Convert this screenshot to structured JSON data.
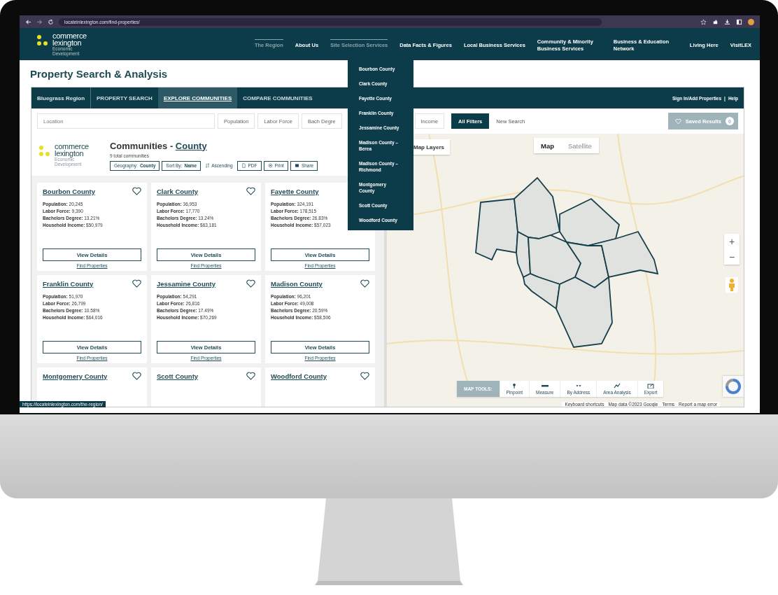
{
  "browser": {
    "url": "locateinlexington.com/find-properties/"
  },
  "site_header": {
    "logo": {
      "line_1": "commerce",
      "line_2": "lexington",
      "tagline_1": "Economic",
      "tagline_2": "Development"
    },
    "nav": [
      {
        "label": "The Region",
        "highlighted": true
      },
      {
        "label": "About Us",
        "highlighted": false
      },
      {
        "label": "Site Selection Services",
        "highlighted": true
      },
      {
        "label": "Data Facts & Figures",
        "highlighted": false
      },
      {
        "label": "Local Business Services",
        "highlighted": false
      },
      {
        "label": "Community & Minority Business Services",
        "highlighted": false
      },
      {
        "label": "Business & Education Network",
        "highlighted": false
      },
      {
        "label": "Living Here",
        "highlighted": false
      },
      {
        "label": "VisitLEX",
        "highlighted": false
      }
    ]
  },
  "region_menu": [
    "Bourbon County",
    "Clark County",
    "Fayette County",
    "Franklin County",
    "Jessamine County",
    "Madison County – Berea",
    "Madison County – Richmond",
    "Montgomery County",
    "Scott County",
    "Woodford County"
  ],
  "page_title": "Property Search & Analysis",
  "region": "Bluegrass Region",
  "tabs": [
    {
      "label": "PROPERTY SEARCH",
      "selected": false
    },
    {
      "label": "EXPLORE COMMUNITIES",
      "selected": true
    },
    {
      "label": "COMPARE COMMUNITIES",
      "selected": false
    }
  ],
  "account_links": [
    "Sign In/Add Properties",
    "Help"
  ],
  "account_separator": "|",
  "filters": {
    "location_placeholder": "Location",
    "chips": [
      "Population",
      "Labor Force",
      "Bach Degre",
      "Income"
    ],
    "all_filters": "All Filters",
    "new_search": "New Search",
    "saved_results": {
      "label": "Saved Results",
      "count": "0"
    }
  },
  "communities": {
    "logo": {
      "line_1": "commerce",
      "line_2": "lexington",
      "tagline_1": "Economic",
      "tagline_2": "Development"
    },
    "title": "Communities - ",
    "title_link": "County",
    "count_text": "9 total communities",
    "controls": [
      {
        "kind": "button",
        "label": "Geography: **County**"
      },
      {
        "kind": "button",
        "label": "Sort By: **Name**"
      },
      {
        "kind": "sort",
        "label": "Ascending"
      },
      {
        "kind": "pdf",
        "label": "PDF"
      },
      {
        "kind": "print",
        "label": "Print"
      },
      {
        "kind": "share",
        "label": "Share"
      }
    ],
    "cards": [
      {
        "name": "Bourbon County",
        "stats": [
          {
            "label": "Population:",
            "value": "20,245"
          },
          {
            "label": "Labor Force:",
            "value": "9,390"
          },
          {
            "label": "Bachelors Degree:",
            "value": "13.21%"
          },
          {
            "label": "Household Income:",
            "value": "$50,979"
          }
        ],
        "button": "View Details",
        "link": "Find Properties"
      },
      {
        "name": "Clark County",
        "stats": [
          {
            "label": "Population:",
            "value": "36,953"
          },
          {
            "label": "Labor Force:",
            "value": "17,770"
          },
          {
            "label": "Bachelors Degree:",
            "value": "13.24%"
          },
          {
            "label": "Household Income:",
            "value": "$63,181"
          }
        ],
        "button": "View Details",
        "link": "Find Properties"
      },
      {
        "name": "Fayette County",
        "stats": [
          {
            "label": "Population:",
            "value": "324,191"
          },
          {
            "label": "Labor Force:",
            "value": "178,515"
          },
          {
            "label": "Bachelors Degree:",
            "value": "26.83%"
          },
          {
            "label": "Household Income:",
            "value": "$57,023"
          }
        ],
        "button": "View Details",
        "link": "Find Properties"
      },
      {
        "name": "Franklin County",
        "stats": [
          {
            "label": "Population:",
            "value": "51,970"
          },
          {
            "label": "Labor Force:",
            "value": "26,799"
          },
          {
            "label": "Bachelors Degree:",
            "value": "10.58%"
          },
          {
            "label": "Household Income:",
            "value": "$64,016"
          }
        ],
        "button": "View Details",
        "link": "Find Properties"
      },
      {
        "name": "Jessamine County",
        "stats": [
          {
            "label": "Population:",
            "value": "54,291"
          },
          {
            "label": "Labor Force:",
            "value": "26,816"
          },
          {
            "label": "Bachelors Degree:",
            "value": "17.49%"
          },
          {
            "label": "Household Income:",
            "value": "$70,269"
          }
        ],
        "button": "View Details",
        "link": "Find Properties"
      },
      {
        "name": "Madison County",
        "stats": [
          {
            "label": "Population:",
            "value": "96,201"
          },
          {
            "label": "Labor Force:",
            "value": "49,008"
          },
          {
            "label": "Bachelors Degree:",
            "value": "20.59%"
          },
          {
            "label": "Household Income:",
            "value": "$58,506"
          }
        ],
        "button": "View Details",
        "link": "Find Properties"
      },
      {
        "name": "Montgomery County"
      },
      {
        "name": "Scott County"
      },
      {
        "name": "Woodford County"
      }
    ]
  },
  "map": {
    "layers_button": "Map Layers",
    "map_types": [
      {
        "label": "Map",
        "selected": true
      },
      {
        "label": "Satellite",
        "selected": false
      }
    ],
    "zoom_in": "+",
    "zoom_out": "−",
    "tools_label": "MAP TOOLS:",
    "tools": [
      {
        "kind": "pin",
        "label": "Pinpoint"
      },
      {
        "kind": "measure",
        "label": "Measure"
      },
      {
        "kind": "address",
        "label": "By Address"
      },
      {
        "kind": "area",
        "label": "Area Analysis"
      },
      {
        "kind": "export",
        "label": "Export"
      }
    ],
    "attribution": [
      "Keyboard shortcuts",
      "Map data ©2023 Google",
      "Terms",
      "Report a map error"
    ]
  },
  "status_url": "https://locateinlexington.com/the-region/"
}
